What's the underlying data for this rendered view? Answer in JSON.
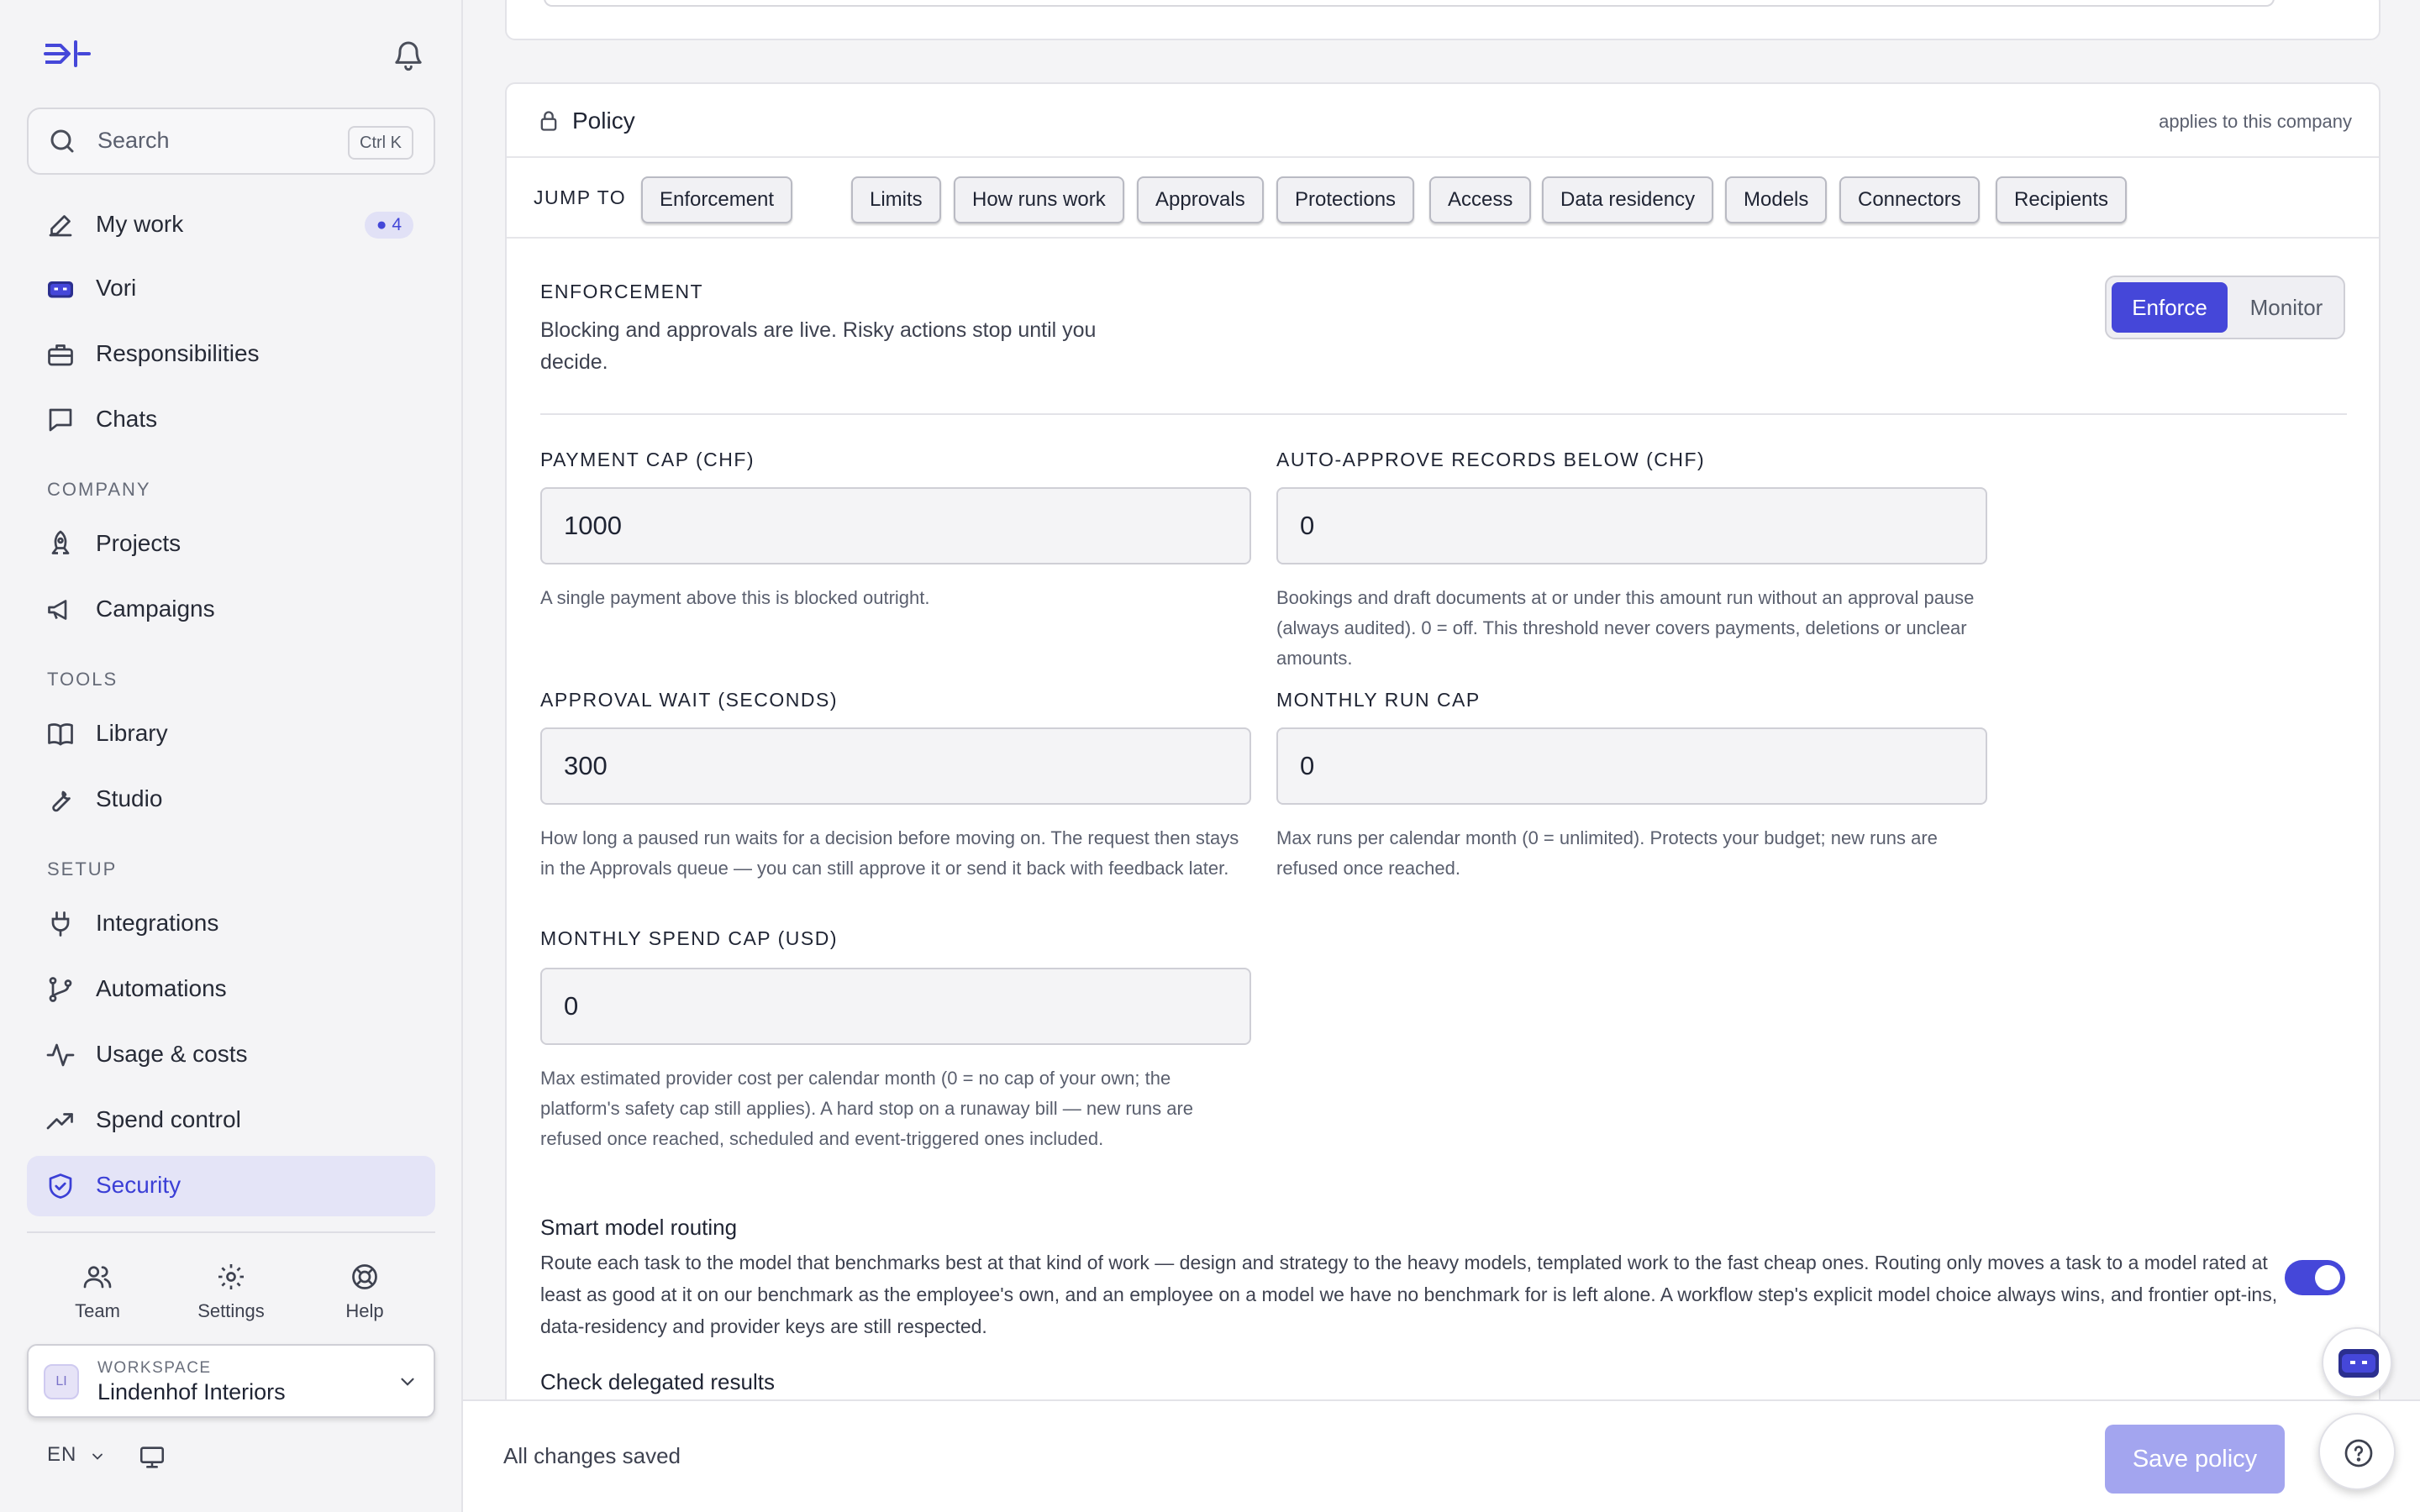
{
  "sidebar": {
    "search": {
      "label": "Search",
      "shortcut": "Ctrl K"
    },
    "nav": {
      "my_work": {
        "label": "My work",
        "badge": "4"
      },
      "vori": {
        "label": "Vori"
      },
      "responsibilities": {
        "label": "Responsibilities"
      },
      "chats": {
        "label": "Chats"
      }
    },
    "sections": {
      "company": "COMPANY",
      "tools": "TOOLS",
      "setup": "SETUP"
    },
    "company_items": {
      "projects": "Projects",
      "campaigns": "Campaigns"
    },
    "tools_items": {
      "library": "Library",
      "studio": "Studio"
    },
    "setup_items": {
      "integrations": "Integrations",
      "automations": "Automations",
      "usage": "Usage & costs",
      "spend": "Spend control",
      "security": "Security"
    },
    "bottom_tabs": {
      "team": "Team",
      "settings": "Settings",
      "help": "Help"
    },
    "workspace": {
      "avatar": "LI",
      "kicker": "WORKSPACE",
      "name": "Lindenhof Interiors"
    },
    "language": "EN"
  },
  "policy": {
    "title": "Policy",
    "scope": "applies to this company",
    "jump_label": "JUMP TO",
    "jump_chips": [
      "Enforcement",
      "Limits",
      "How runs work",
      "Approvals",
      "Protections",
      "Access",
      "Data residency",
      "Models",
      "Connectors",
      "Recipients"
    ],
    "enforcement": {
      "title": "ENFORCEMENT",
      "description": "Blocking and approvals are live. Risky actions stop until you decide.",
      "options": [
        "Enforce",
        "Monitor"
      ],
      "selected": "Enforce"
    },
    "fields": {
      "payment_cap": {
        "label": "PAYMENT CAP (CHF)",
        "value": "1000",
        "help": "A single payment above this is blocked outright."
      },
      "auto_approve": {
        "label": "AUTO-APPROVE RECORDS BELOW (CHF)",
        "value": "0",
        "help": "Bookings and draft documents at or under this amount run without an approval pause (always audited). 0 = off. This threshold never covers payments, deletions or unclear amounts."
      },
      "approval_wait": {
        "label": "APPROVAL WAIT (SECONDS)",
        "value": "300",
        "help": "How long a paused run waits for a decision before moving on. The request then stays in the Approvals queue — you can still approve it or send it back with feedback later."
      },
      "monthly_run_cap": {
        "label": "MONTHLY RUN CAP",
        "value": "0",
        "help": "Max runs per calendar month (0 = unlimited). Protects your budget; new runs are refused once reached."
      },
      "monthly_spend_cap": {
        "label": "MONTHLY SPEND CAP (USD)",
        "value": "0",
        "help": "Max estimated provider cost per calendar month (0 = no cap of your own; the platform's safety cap still applies). A hard stop on a runaway bill — new runs are refused once reached, scheduled and event-triggered ones included."
      }
    },
    "smart_routing": {
      "title": "Smart model routing",
      "description": "Route each task to the model that benchmarks best at that kind of work — design and strategy to the heavy models, templated work to the fast cheap ones. Routing only moves a task to a model rated at least as good at it on our benchmark as the employee's own, and an employee on a model we have no benchmark for is left alone. A workflow step's explicit model choice always wins, and frontier opt-ins, data-residency and provider keys are still respected.",
      "enabled": true
    },
    "check_delegated": {
      "title": "Check delegated results"
    }
  },
  "footer": {
    "status": "All changes saved",
    "save_label": "Save policy"
  },
  "colors": {
    "accent": "#4547d9",
    "active_nav_bg": "#e4e4f7",
    "save_disabled": "#a3a5ef"
  },
  "icons": [
    "logo-icon",
    "bell-icon",
    "search-icon",
    "pencil-icon",
    "robot-icon",
    "briefcase-icon",
    "chat-icon",
    "rocket-icon",
    "megaphone-icon",
    "book-icon",
    "wrench-icon",
    "plug-icon",
    "branch-icon",
    "activity-icon",
    "trend-icon",
    "shield-icon",
    "users-icon",
    "gear-icon",
    "lifebuoy-icon",
    "chevron-down-icon",
    "monitor-icon",
    "lock-icon",
    "help-icon"
  ]
}
